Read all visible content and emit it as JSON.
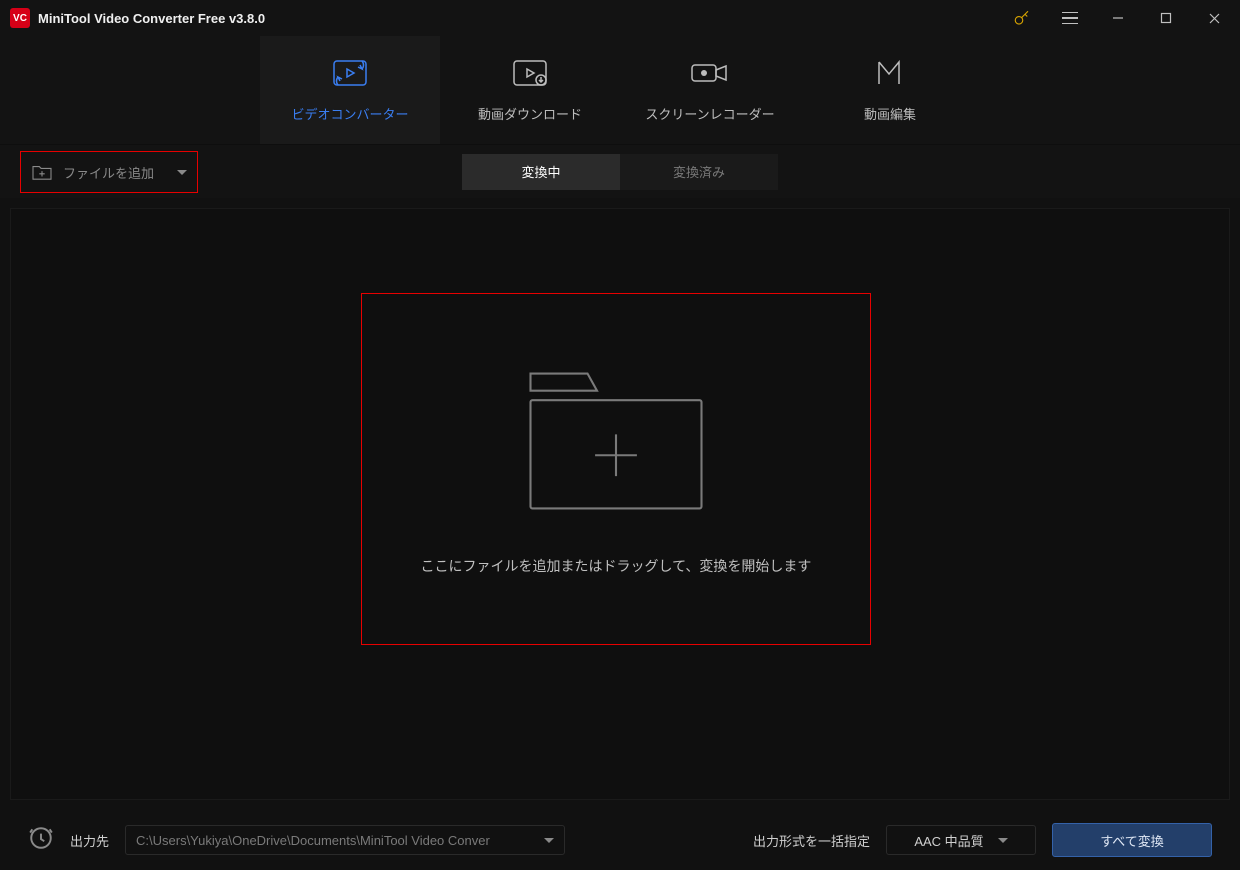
{
  "titlebar": {
    "title": "MiniTool Video Converter Free v3.8.0"
  },
  "topnav": {
    "tabs": [
      {
        "label": "ビデオコンバーター"
      },
      {
        "label": "動画ダウンロード"
      },
      {
        "label": "スクリーンレコーダー"
      },
      {
        "label": "動画編集"
      }
    ]
  },
  "subbar": {
    "add_file_label": "ファイルを追加",
    "tabs": [
      {
        "label": "変換中"
      },
      {
        "label": "変換済み"
      }
    ]
  },
  "dropzone": {
    "text": "ここにファイルを追加またはドラッグして、変換を開始します"
  },
  "bottombar": {
    "output_label": "出力先",
    "output_path": "C:\\Users\\Yukiya\\OneDrive\\Documents\\MiniTool Video Conver",
    "format_label": "出力形式を一括指定",
    "format_value": "AAC 中品質",
    "convert_label": "すべて変換"
  }
}
